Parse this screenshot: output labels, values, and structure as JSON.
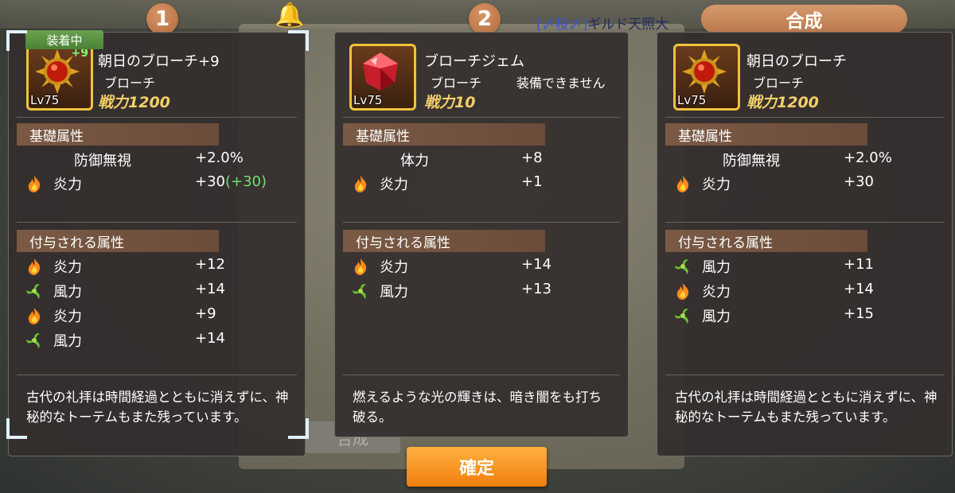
{
  "top": {
    "badge1": "1",
    "badge2": "2",
    "guild_text": "ギルド天照大",
    "guild_symbol": "[〆桜〆]",
    "result_header": "合成"
  },
  "background": {
    "ghost_button": "合成"
  },
  "panels": [
    {
      "equipped_tag": "装着中",
      "item": {
        "name": "朝日のブローチ+9",
        "type": "ブローチ",
        "note": "",
        "power": "戦力1200",
        "level": "Lv75",
        "enhance": "+9",
        "icon": "sun-brooch-icon"
      },
      "basic_header": "基礎属性",
      "basic": [
        {
          "name": "防御無視",
          "value": "+2.0%",
          "bonus": "",
          "icon": ""
        },
        {
          "name": "炎力",
          "value": "+30",
          "bonus": "(+30)",
          "icon": "fire-icon"
        }
      ],
      "granted_header": "付与される属性",
      "granted": [
        {
          "name": "炎力",
          "value": "+12",
          "icon": "fire-icon"
        },
        {
          "name": "風力",
          "value": "+14",
          "icon": "wind-icon"
        },
        {
          "name": "炎力",
          "value": "+9",
          "icon": "fire-icon"
        },
        {
          "name": "風力",
          "value": "+14",
          "icon": "wind-icon"
        }
      ],
      "description": "古代の礼拝は時間経過とともに消えずに、神秘的なトーテムもまた残っています。"
    },
    {
      "equipped_tag": "",
      "item": {
        "name": "ブローチジェム",
        "type": "ブローチ",
        "note": "装備できません",
        "power": "戦力10",
        "level": "Lv75",
        "enhance": "",
        "icon": "red-gem-icon"
      },
      "basic_header": "基礎属性",
      "basic": [
        {
          "name": "体力",
          "value": "+8",
          "bonus": "",
          "icon": ""
        },
        {
          "name": "炎力",
          "value": "+1",
          "bonus": "",
          "icon": "fire-icon"
        }
      ],
      "granted_header": "付与される属性",
      "granted": [
        {
          "name": "炎力",
          "value": "+14",
          "icon": "fire-icon"
        },
        {
          "name": "風力",
          "value": "+13",
          "icon": "wind-icon"
        }
      ],
      "description": "燃えるような光の輝きは、暗き闇をも打ち破る。"
    },
    {
      "equipped_tag": "",
      "item": {
        "name": "朝日のブローチ",
        "type": "ブローチ",
        "note": "",
        "power": "戦力1200",
        "level": "Lv75",
        "enhance": "",
        "icon": "sun-brooch-icon"
      },
      "basic_header": "基礎属性",
      "basic": [
        {
          "name": "防御無視",
          "value": "+2.0%",
          "bonus": "",
          "icon": ""
        },
        {
          "name": "炎力",
          "value": "+30",
          "bonus": "",
          "icon": "fire-icon"
        }
      ],
      "granted_header": "付与される属性",
      "granted": [
        {
          "name": "風力",
          "value": "+11",
          "icon": "wind-icon"
        },
        {
          "name": "炎力",
          "value": "+14",
          "icon": "fire-icon"
        },
        {
          "name": "風力",
          "value": "+15",
          "icon": "wind-icon"
        }
      ],
      "description": "古代の礼拝は時間経過とともに消えずに、神秘的なトーテムもまた残っています。"
    }
  ],
  "confirm_button": "確定",
  "colors": {
    "accent_orange": "#f59416",
    "power_gold": "#f4d067",
    "equipped_green": "#5a9a40",
    "bonus_green": "#6fe06f"
  }
}
